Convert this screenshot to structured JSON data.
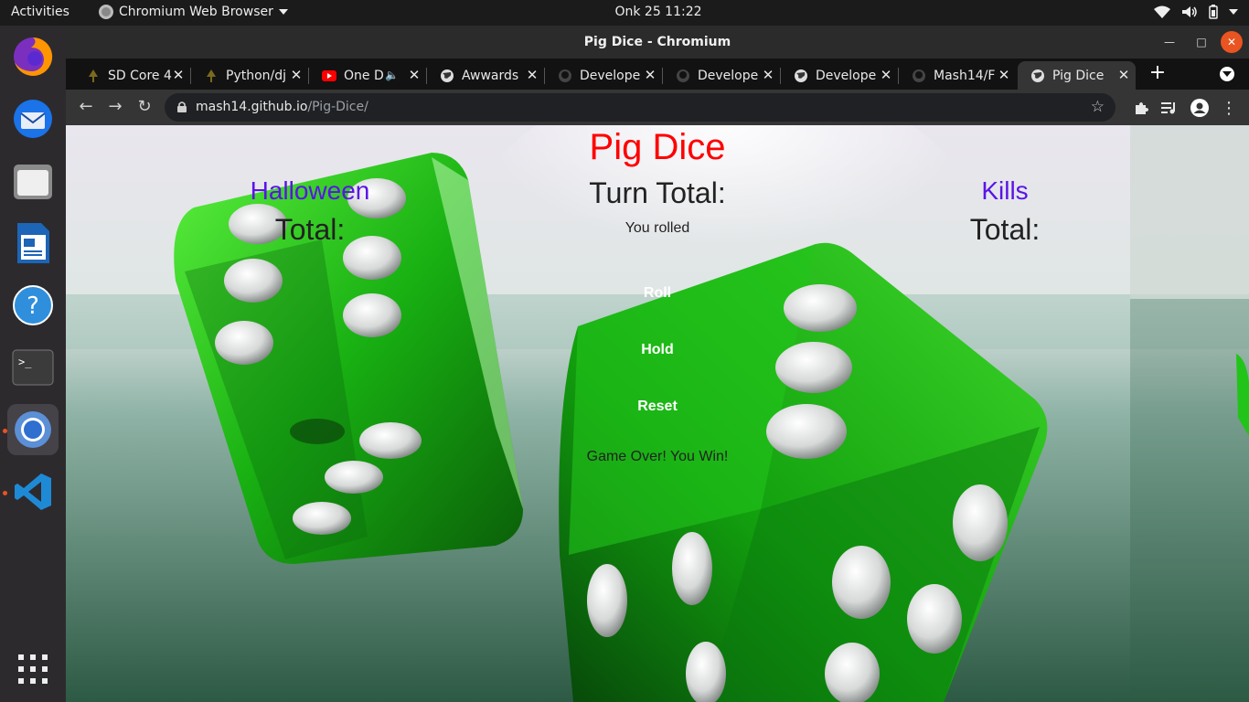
{
  "topbar": {
    "activities": "Activities",
    "app_menu": "Chromium Web Browser",
    "clock": "Onk 25  11:22"
  },
  "dock": {
    "items": [
      "firefox",
      "thunderbird",
      "files",
      "libreoffice-writer",
      "help",
      "terminal",
      "chromium",
      "vscode"
    ]
  },
  "window": {
    "title": "Pig Dice - Chromium"
  },
  "tabs": [
    {
      "label": "SD Core 4",
      "icon": "tree-icon"
    },
    {
      "label": "Python/dj",
      "icon": "tree-icon"
    },
    {
      "label": "One D",
      "icon": "youtube-icon"
    },
    {
      "label": "Awwards",
      "icon": "globe-icon"
    },
    {
      "label": "Develope",
      "icon": "github-icon"
    },
    {
      "label": "Develope",
      "icon": "github-icon"
    },
    {
      "label": "Develope",
      "icon": "globe-icon"
    },
    {
      "label": "Mash14/F",
      "icon": "github-icon"
    },
    {
      "label": "Pig Dice",
      "icon": "globe-icon"
    }
  ],
  "omnibox": {
    "host": "mash14.github.io",
    "path": "/Pig-Dice/"
  },
  "game": {
    "title": "Pig Dice",
    "turn_total": "Turn Total:",
    "you_rolled": "You rolled",
    "roll": "Roll",
    "hold": "Hold",
    "reset": "Reset",
    "status": "Game Over! You Win!",
    "player1": {
      "name": "Halloween",
      "total": "Total:"
    },
    "player2": {
      "name": "Kills",
      "total": "Total:"
    }
  },
  "colors": {
    "title": "#ff0000",
    "player_name": "#5a14e6",
    "ubuntu_accent": "#e95420",
    "dice_green": "#22c41a"
  }
}
